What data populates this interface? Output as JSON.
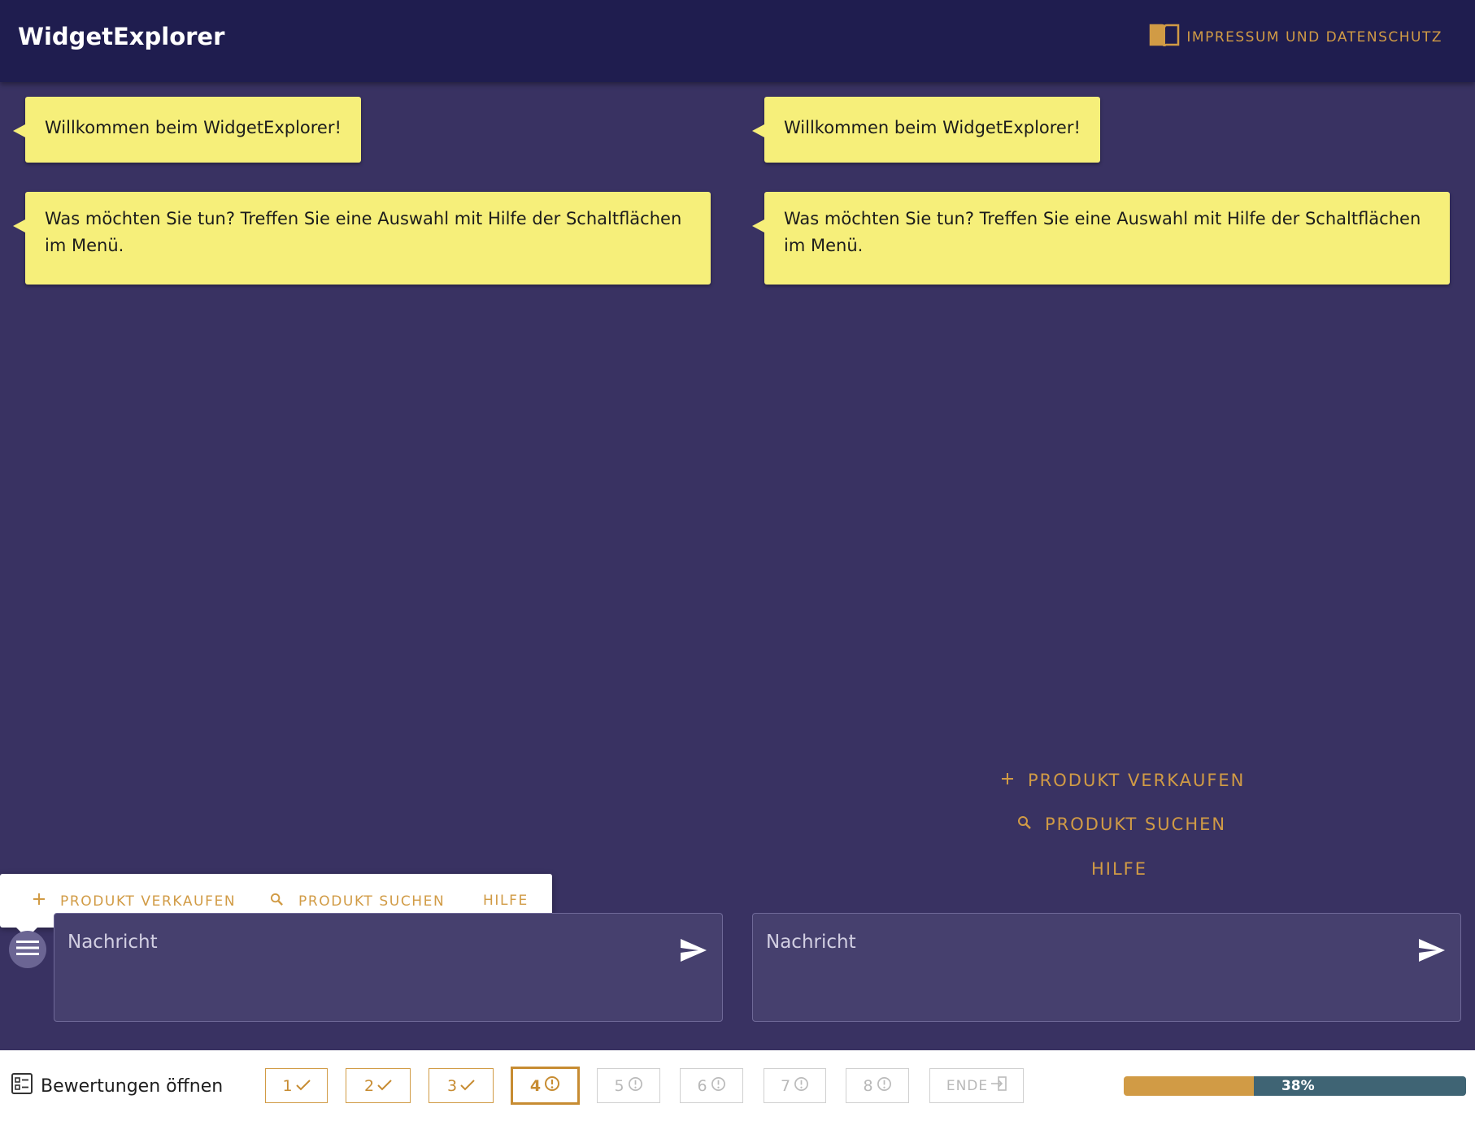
{
  "header": {
    "app_title": "WidgetExplorer",
    "impressum_label": "IMPRESSUM UND DATENSCHUTZ"
  },
  "left_chat": {
    "bubbles": [
      "Willkommen beim WidgetExplorer!",
      "Was möchten Sie tun? Treffen Sie eine Auswahl mit Hilfe der Schaltflächen im Menü."
    ],
    "menu_popup": [
      {
        "label": "PRODUKT VERKAUFEN",
        "icon": "plus-icon"
      },
      {
        "label": "PRODUKT SUCHEN",
        "icon": "search-icon"
      },
      {
        "label": "HILFE",
        "icon": ""
      }
    ],
    "input_placeholder": "Nachricht"
  },
  "right_chat": {
    "bubbles": [
      "Willkommen beim WidgetExplorer!",
      "Was möchten Sie tun? Treffen Sie eine Auswahl mit Hilfe der Schaltflächen im Menü."
    ],
    "menu": [
      {
        "label": "PRODUKT VERKAUFEN",
        "icon": "plus-icon"
      },
      {
        "label": "PRODUKT SUCHEN",
        "icon": "search-icon"
      },
      {
        "label": "HILFE",
        "icon": ""
      }
    ],
    "input_placeholder": "Nachricht"
  },
  "footer": {
    "ratings_label": "Bewertungen öffnen",
    "steps": [
      {
        "label": "1",
        "state": "done",
        "icon": "check-icon"
      },
      {
        "label": "2",
        "state": "done",
        "icon": "check-icon"
      },
      {
        "label": "3",
        "state": "done",
        "icon": "check-icon"
      },
      {
        "label": "4",
        "state": "current",
        "icon": "alert-circle-icon"
      },
      {
        "label": "5",
        "state": "pending",
        "icon": "alert-circle-icon"
      },
      {
        "label": "6",
        "state": "pending",
        "icon": "alert-circle-icon"
      },
      {
        "label": "7",
        "state": "pending",
        "icon": "alert-circle-icon"
      },
      {
        "label": "8",
        "state": "pending",
        "icon": "alert-circle-icon"
      },
      {
        "label": "ENDE",
        "state": "pending",
        "icon": "exit-icon"
      }
    ],
    "progress_value": 0.38,
    "progress_label": "38%"
  },
  "colors": {
    "header_bg": "#1f1d4f",
    "page_bg": "#393262",
    "accent": "#d19b45",
    "bubble": "#f6ef7a",
    "progress_rest": "#3f6474"
  }
}
